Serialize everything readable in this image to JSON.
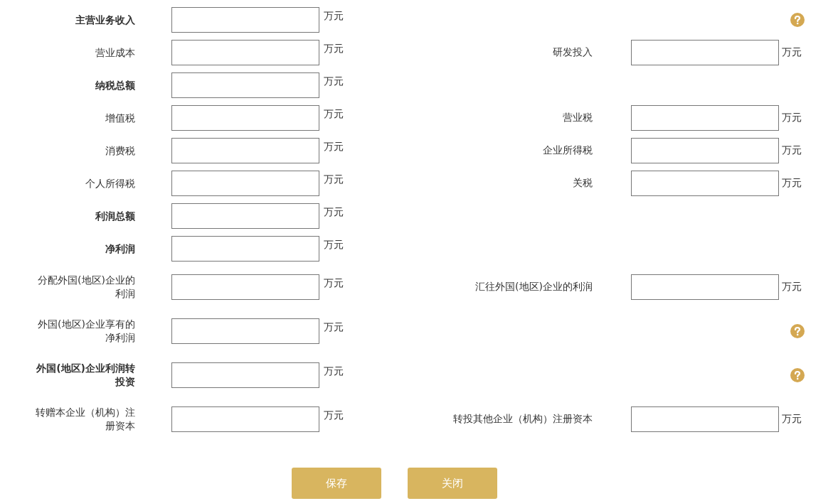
{
  "rows": [
    {
      "left": {
        "label": "主营业务收入",
        "bold": true,
        "unit": "万元"
      },
      "help": true
    },
    {
      "left": {
        "label": "营业成本",
        "bold": false,
        "unit": "万元"
      },
      "right": {
        "label": "研发投入",
        "unit": "万元"
      }
    },
    {
      "left": {
        "label": "纳税总额",
        "bold": true,
        "unit": "万元"
      }
    },
    {
      "left": {
        "label": "增值税",
        "bold": false,
        "unit": "万元"
      },
      "right": {
        "label": "营业税",
        "unit": "万元"
      }
    },
    {
      "left": {
        "label": "消费税",
        "bold": false,
        "unit": "万元"
      },
      "right": {
        "label": "企业所得税",
        "unit": "万元"
      }
    },
    {
      "left": {
        "label": "个人所得税",
        "bold": false,
        "unit": "万元"
      },
      "right": {
        "label": "关税",
        "unit": "万元"
      }
    },
    {
      "left": {
        "label": "利润总额",
        "bold": true,
        "unit": "万元"
      }
    },
    {
      "left": {
        "label": "净利润",
        "bold": true,
        "unit": "万元"
      }
    },
    {
      "left": {
        "label": "分配外国(地区)企业的利润",
        "bold": false,
        "unit": "万元"
      },
      "right": {
        "label": "汇往外国(地区)企业的利润",
        "unit": "万元"
      }
    },
    {
      "left": {
        "label": "外国(地区)企业享有的净利润",
        "bold": false,
        "unit": "万元"
      },
      "help": true
    },
    {
      "left": {
        "label": "外国(地区)企业利润转投资",
        "bold": true,
        "unit": "万元"
      },
      "help": true
    },
    {
      "left": {
        "label": "转赠本企业（机构）注册资本",
        "bold": false,
        "unit": "万元"
      },
      "right": {
        "label": "转投其他企业（机构）注册资本",
        "unit": "万元"
      }
    }
  ],
  "buttons": [
    {
      "label": "保存"
    },
    {
      "label": "关闭"
    }
  ]
}
